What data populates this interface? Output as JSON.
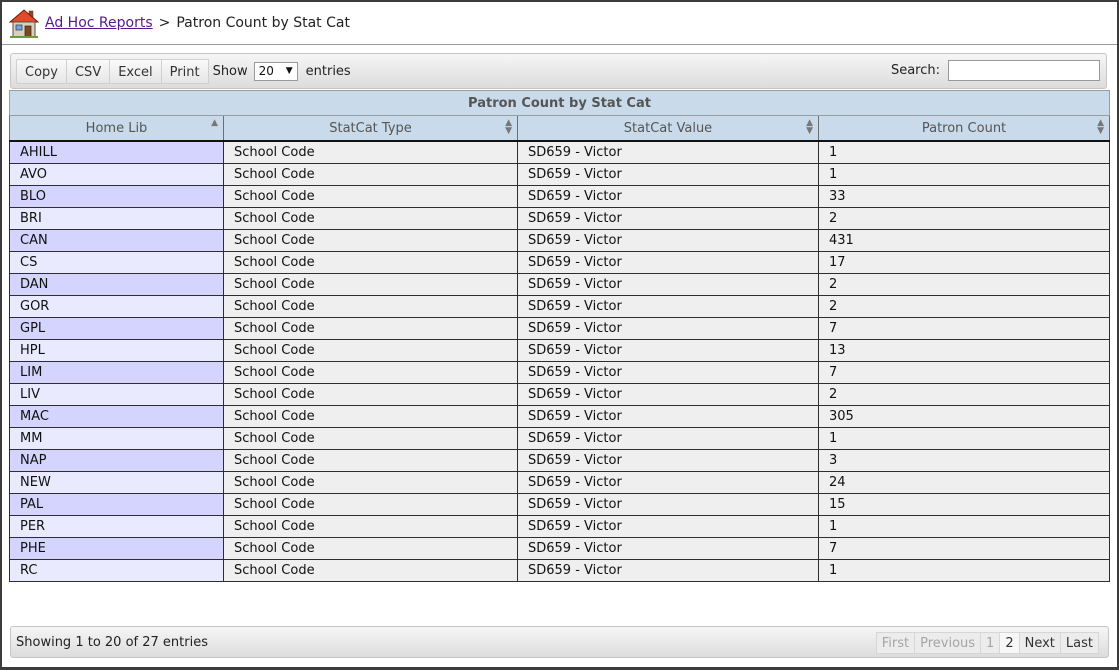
{
  "breadcrumb": {
    "parent": "Ad Hoc Reports",
    "separator": ">",
    "current": "Patron Count by Stat Cat"
  },
  "toolbar": {
    "buttons": [
      "Copy",
      "CSV",
      "Excel",
      "Print"
    ],
    "show_label": "Show",
    "page_size": "20",
    "entries_label": "entries",
    "search_label": "Search:",
    "search_value": ""
  },
  "table": {
    "caption": "Patron Count by Stat Cat",
    "columns": [
      "Home Lib",
      "StatCat Type",
      "StatCat Value",
      "Patron Count"
    ],
    "sort_column": "Home Lib",
    "rows": [
      [
        "AHILL",
        "School Code",
        "SD659 - Victor",
        "1"
      ],
      [
        "AVO",
        "School Code",
        "SD659 - Victor",
        "1"
      ],
      [
        "BLO",
        "School Code",
        "SD659 - Victor",
        "33"
      ],
      [
        "BRI",
        "School Code",
        "SD659 - Victor",
        "2"
      ],
      [
        "CAN",
        "School Code",
        "SD659 - Victor",
        "431"
      ],
      [
        "CS",
        "School Code",
        "SD659 - Victor",
        "17"
      ],
      [
        "DAN",
        "School Code",
        "SD659 - Victor",
        "2"
      ],
      [
        "GOR",
        "School Code",
        "SD659 - Victor",
        "2"
      ],
      [
        "GPL",
        "School Code",
        "SD659 - Victor",
        "7"
      ],
      [
        "HPL",
        "School Code",
        "SD659 - Victor",
        "13"
      ],
      [
        "LIM",
        "School Code",
        "SD659 - Victor",
        "7"
      ],
      [
        "LIV",
        "School Code",
        "SD659 - Victor",
        "2"
      ],
      [
        "MAC",
        "School Code",
        "SD659 - Victor",
        "305"
      ],
      [
        "MM",
        "School Code",
        "SD659 - Victor",
        "1"
      ],
      [
        "NAP",
        "School Code",
        "SD659 - Victor",
        "3"
      ],
      [
        "NEW",
        "School Code",
        "SD659 - Victor",
        "24"
      ],
      [
        "PAL",
        "School Code",
        "SD659 - Victor",
        "15"
      ],
      [
        "PER",
        "School Code",
        "SD659 - Victor",
        "1"
      ],
      [
        "PHE",
        "School Code",
        "SD659 - Victor",
        "7"
      ],
      [
        "RC",
        "School Code",
        "SD659 - Victor",
        "1"
      ]
    ]
  },
  "footer": {
    "info": "Showing 1 to 20 of 27 entries",
    "pager": {
      "first": "First",
      "previous": "Previous",
      "pages": [
        "1",
        "2"
      ],
      "current_page": "1",
      "next": "Next",
      "last": "Last"
    }
  },
  "colors": {
    "header_bg": "#c9dbea",
    "lib_odd": "#d4d4ff",
    "lib_even": "#eaeaff",
    "link": "#551a8b"
  },
  "icons": {
    "home": "home-icon"
  }
}
